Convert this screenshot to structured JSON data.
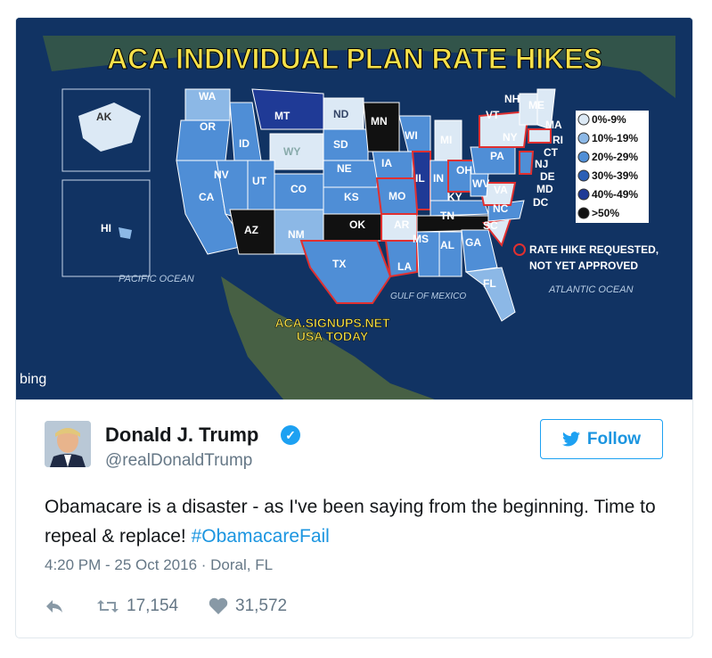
{
  "media": {
    "title": "ACA INDIVIDUAL PLAN RATE HIKES",
    "states": [
      "WA",
      "OR",
      "CA",
      "NV",
      "ID",
      "MT",
      "WY",
      "UT",
      "AZ",
      "CO",
      "NM",
      "ND",
      "SD",
      "NE",
      "KS",
      "OK",
      "TX",
      "MN",
      "IA",
      "MO",
      "AR",
      "LA",
      "WI",
      "IL",
      "MI",
      "IN",
      "OH",
      "KY",
      "TN",
      "MS",
      "AL",
      "GA",
      "FL",
      "SC",
      "NC",
      "VA",
      "WV",
      "PA",
      "NY",
      "VT",
      "NH",
      "ME",
      "MA",
      "RI",
      "CT",
      "NJ",
      "DE",
      "MD",
      "DC",
      "AK",
      "HI"
    ],
    "legend": [
      {
        "label": "0%-9%",
        "color": "#dce9f5"
      },
      {
        "label": "10%-19%",
        "color": "#8cb8e6"
      },
      {
        "label": "20%-29%",
        "color": "#4f8ed6"
      },
      {
        "label": "30%-39%",
        "color": "#2c5fb5"
      },
      {
        "label": "40%-49%",
        "color": "#1f3a96"
      },
      {
        "label": ">50%",
        "color": "#111111"
      }
    ],
    "pending_legend": [
      "RATE HIKE REQUESTED,",
      "NOT YET APPROVED"
    ],
    "ocean_labels": {
      "pacific": "PACIFIC OCEAN",
      "atlantic": "ATLANTIC OCEAN",
      "gulf": "GULF OF MEXICO"
    },
    "source_lines": [
      "ACA.SIGNUPS.NET",
      "USA TODAY"
    ],
    "watermark": "bing"
  },
  "tweet": {
    "author_name": "Donald J. Trump",
    "handle": "@realDonaldTrump",
    "follow_label": "Follow",
    "text": "Obamacare is a disaster - as I've been saying from the beginning. Time to repeal & replace! ",
    "hashtag": "#ObamacareFail",
    "timestamp": "4:20 PM - 25 Oct 2016 · Doral, FL",
    "retweets": "17,154",
    "likes": "31,572"
  },
  "colors": {
    "accent": "#1da1f2",
    "link": "#1b95e0",
    "muted": "#657786"
  }
}
